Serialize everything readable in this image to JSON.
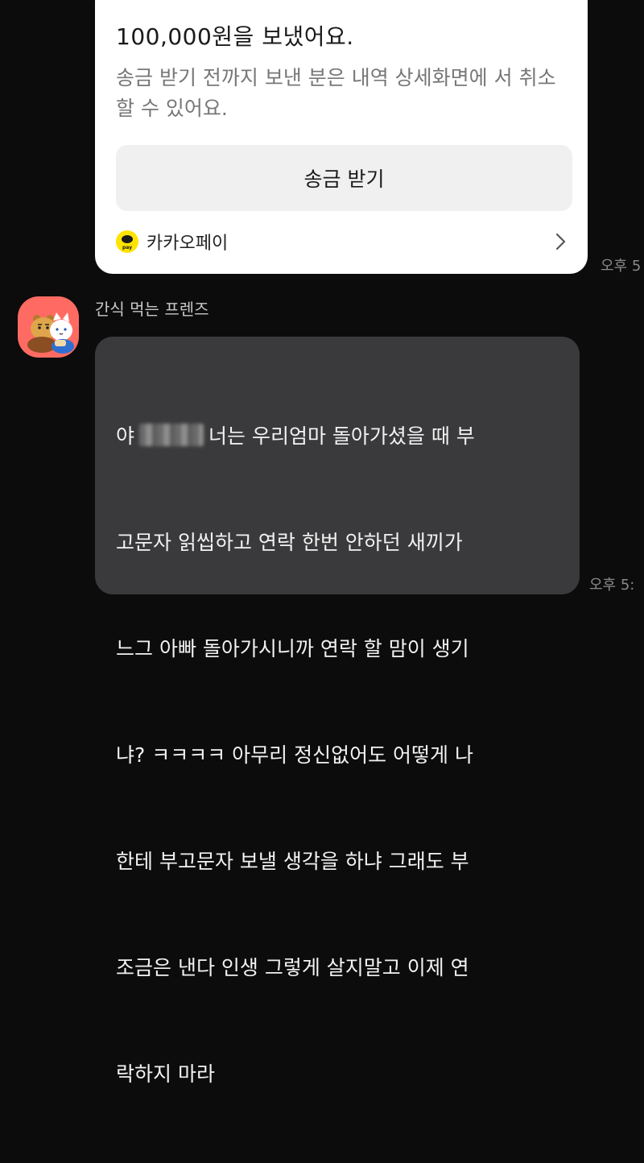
{
  "payment_card": {
    "title": "100,000원을 보냈어요.",
    "description": "송금 받기 전까지 보낸 분은 내역 상세화면에 서 취소할 수 있어요.",
    "button_label": "송금 받기",
    "brand": "카카오페이",
    "logo_text": "pay",
    "time": "오후 5"
  },
  "message": {
    "sender": "간식 먹는 프렌즈",
    "lines": [
      [
        "야",
        "너는 우리엄마 돌아가셨을 때 부"
      ],
      "고문자 읽씹하고 연락 한번 안하던 새끼가",
      "느그 아빠 돌아가시니까 연락 할 맘이 생기",
      "냐? ㅋㅋㅋㅋ 아무리 정신없어도 어떻게 나",
      "한테 부고문자 보낼 생각을 하냐 그래도 부",
      "조금은 낸다 인생 그렇게 살지말고 이제 연",
      "락하지 마라"
    ],
    "time": "오후 5:"
  },
  "colors": {
    "background": "#0c0c0c",
    "card": "#ffffff",
    "bubble": "#3a3a3c",
    "kakaopay_yellow": "#ffe300",
    "avatar_bg": "#ff6b62"
  },
  "icons": [
    "kakaopay-logo-icon",
    "chevron-right-icon",
    "friends-avatar-icon"
  ]
}
